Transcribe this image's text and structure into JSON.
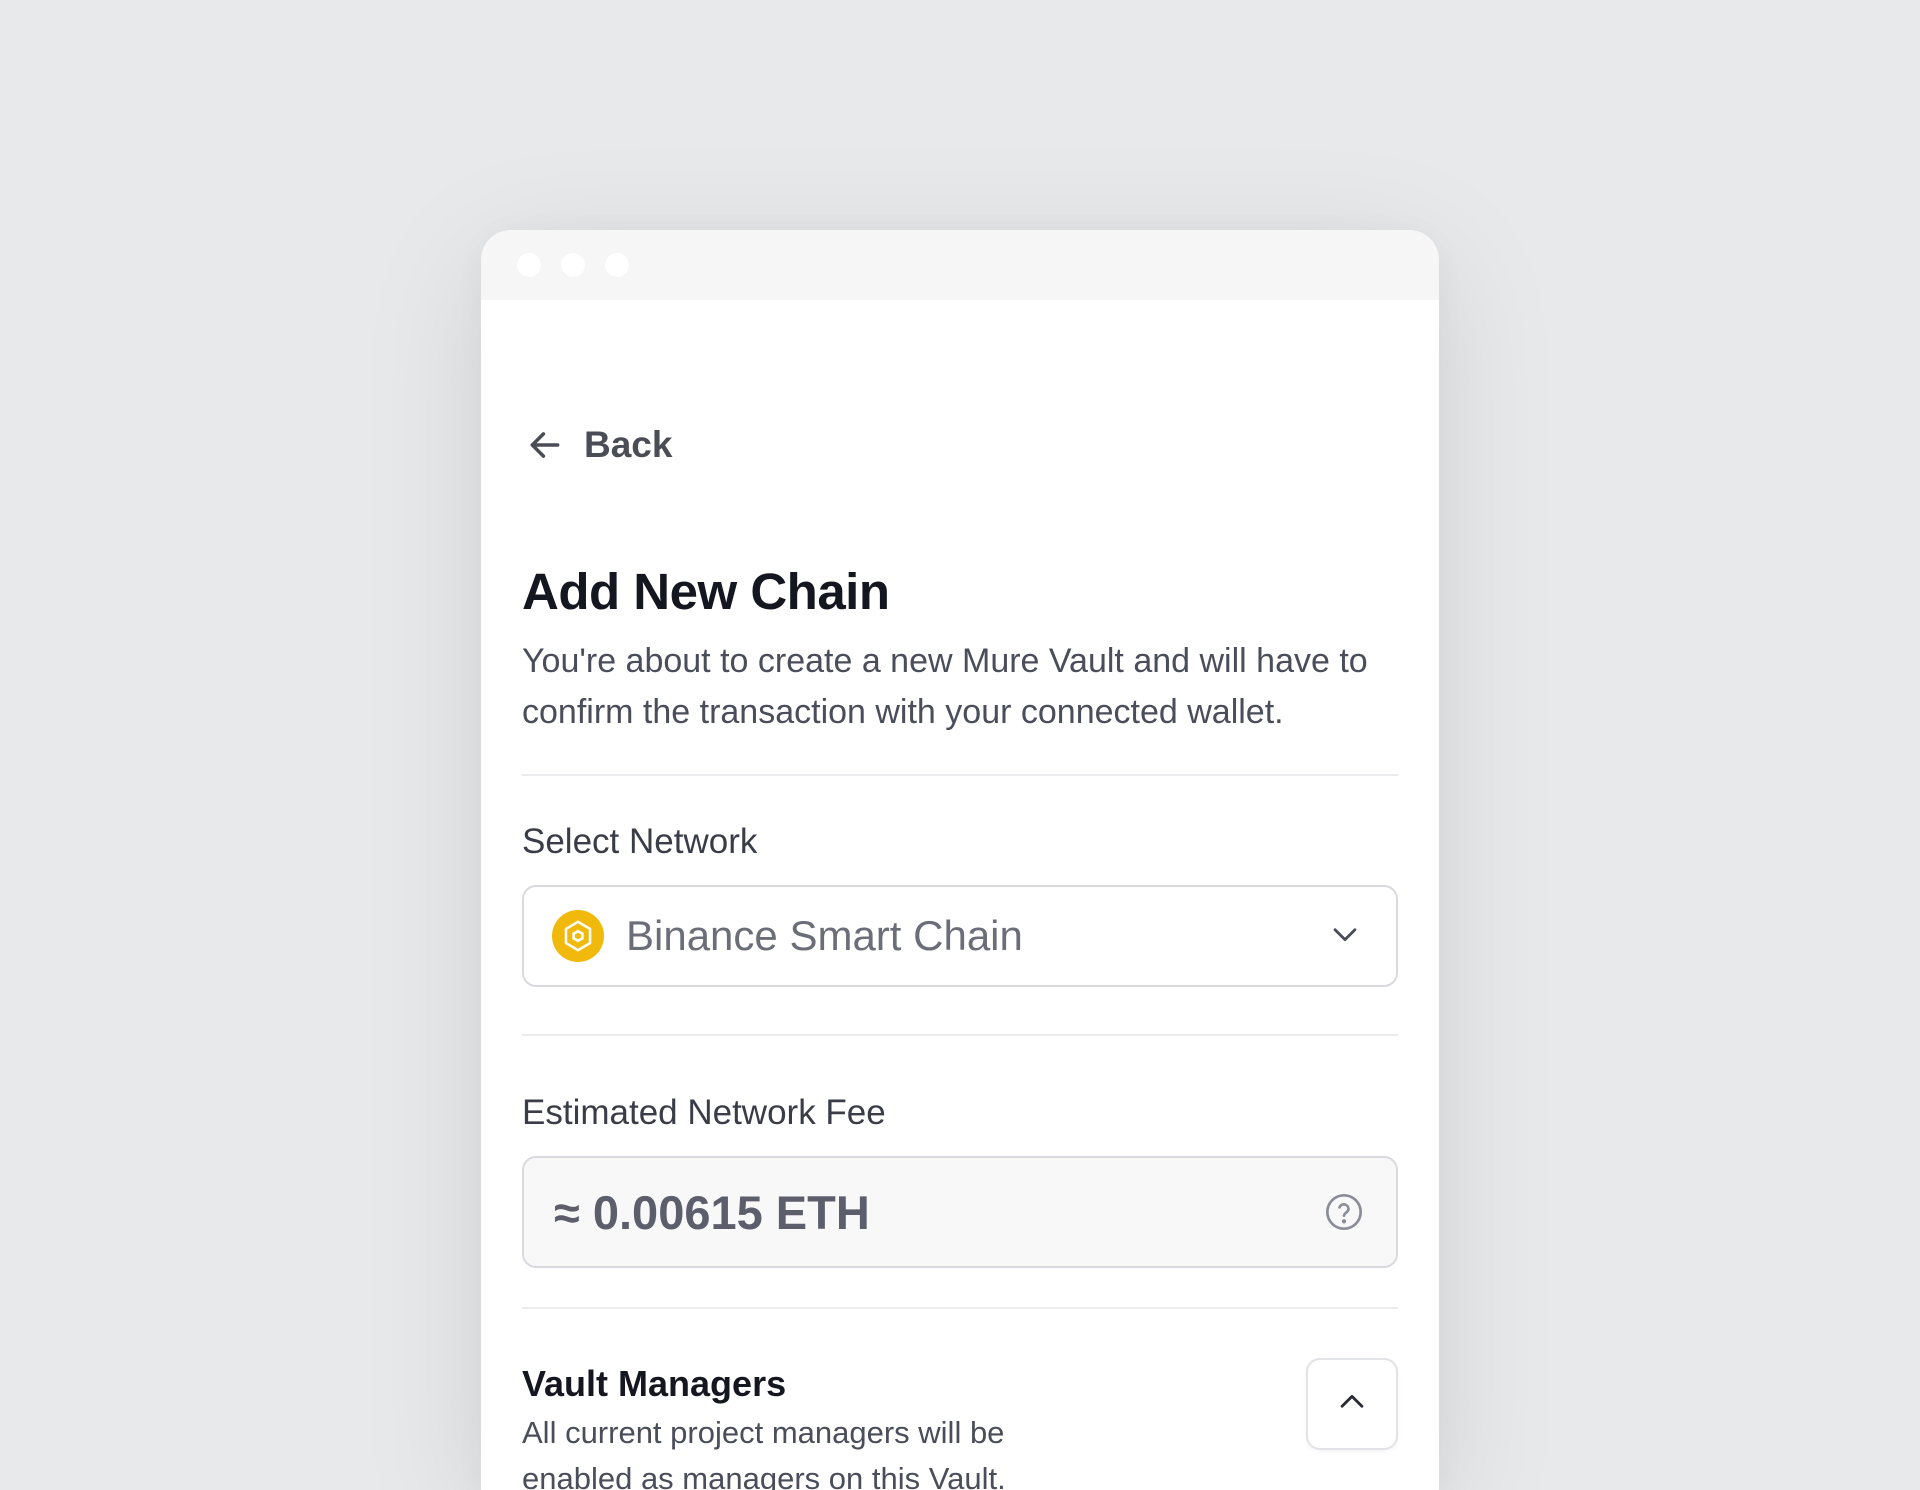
{
  "back": {
    "label": "Back"
  },
  "header": {
    "title": "Add New Chain",
    "subtitle": "You're about to create a new Mure Vault and will have to confirm the transaction with your connected wallet."
  },
  "network": {
    "label": "Select Network",
    "selected": "Binance Smart Chain",
    "icon": "bnb-logo-icon",
    "icon_color": "#f0b90b"
  },
  "fee": {
    "label": "Estimated Network Fee",
    "value": "≈ 0.00615 ETH"
  },
  "vault_managers": {
    "title": "Vault Managers",
    "description": "All current project managers will be enabled as managers on this Vault."
  }
}
